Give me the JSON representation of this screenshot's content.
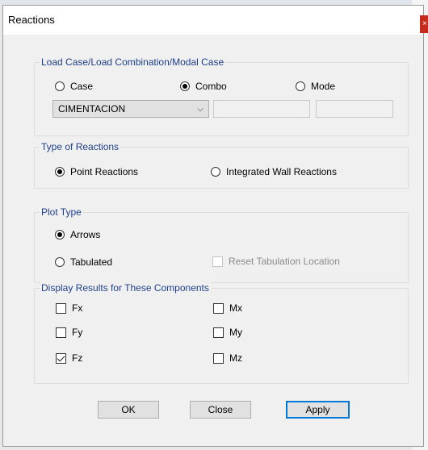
{
  "window": {
    "title": "Reactions",
    "close_icon": "×"
  },
  "load_case": {
    "legend": "Load Case/Load Combination/Modal Case",
    "options": [
      {
        "label": "Case",
        "selected": false
      },
      {
        "label": "Combo",
        "selected": true
      },
      {
        "label": "Mode",
        "selected": false
      }
    ],
    "combo_value": "CIMENTACION",
    "dropdown_icon": "⌵"
  },
  "reaction_type": {
    "legend": "Type of Reactions",
    "options": [
      {
        "label": "Point Reactions",
        "selected": true
      },
      {
        "label": "Integrated Wall Reactions",
        "selected": false
      }
    ]
  },
  "plot_type": {
    "legend": "Plot Type",
    "options": [
      {
        "label": "Arrows",
        "selected": true
      },
      {
        "label": "Tabulated",
        "selected": false
      }
    ],
    "reset_label": "Reset Tabulation Location",
    "reset_checked": false,
    "reset_enabled": false
  },
  "components": {
    "legend": "Display Results for These Components",
    "items": [
      {
        "label": "Fx",
        "checked": false
      },
      {
        "label": "Fy",
        "checked": false
      },
      {
        "label": "Fz",
        "checked": true
      },
      {
        "label": "Mx",
        "checked": false
      },
      {
        "label": "My",
        "checked": false
      },
      {
        "label": "Mz",
        "checked": false
      }
    ]
  },
  "buttons": {
    "ok": "OK",
    "close": "Close",
    "apply": "Apply"
  }
}
